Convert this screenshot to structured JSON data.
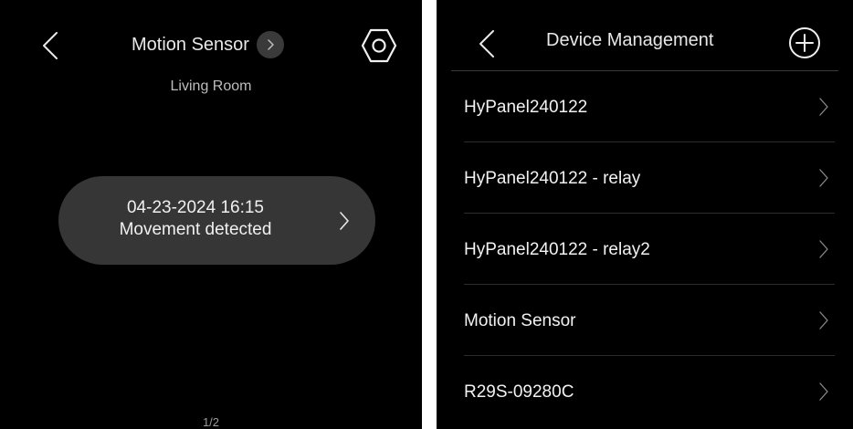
{
  "left_screen": {
    "title": "Motion Sensor",
    "room": "Living Room",
    "event": {
      "time": "04-23-2024 16:15",
      "description": "Movement detected"
    },
    "pager": "1/2"
  },
  "right_screen": {
    "title": "Device Management",
    "devices": [
      {
        "name": "HyPanel240122"
      },
      {
        "name": "HyPanel240122 - relay"
      },
      {
        "name": "HyPanel240122 - relay2"
      },
      {
        "name": "Motion Sensor"
      },
      {
        "name": "R29S-09280C"
      }
    ]
  },
  "icons": {
    "back": "chevron-left-icon",
    "title_more": "chevron-right-icon",
    "settings": "hexagon-settings-icon",
    "event_more": "chevron-right-icon",
    "add": "plus-circle-icon",
    "row_more": "chevron-right-icon"
  },
  "colors": {
    "background": "#000000",
    "pill": "#363636",
    "text": "#f0f0f0",
    "muted": "#bdbdbd",
    "divider": "#2c2c2c"
  }
}
